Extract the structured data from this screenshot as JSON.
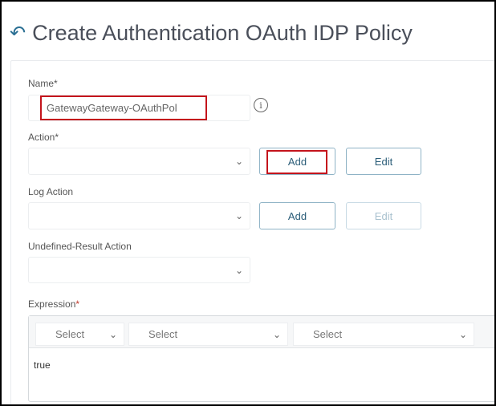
{
  "header": {
    "title": "Create Authentication OAuth IDP Policy",
    "back_icon": "back-arrow-icon"
  },
  "form": {
    "name": {
      "label": "Name",
      "required_mark": "*",
      "value": "GatewayGateway-OAuthPol"
    },
    "action": {
      "label": "Action",
      "required_mark": "*",
      "value": "",
      "add_label": "Add",
      "edit_label": "Edit"
    },
    "log_action": {
      "label": "Log Action",
      "value": "",
      "add_label": "Add",
      "edit_label": "Edit"
    },
    "undefined_result_action": {
      "label": "Undefined-Result Action",
      "value": ""
    },
    "expression": {
      "label": "Expression",
      "required_mark": "*",
      "selects": [
        "Select",
        "Select",
        "Select"
      ],
      "value": "true"
    }
  },
  "highlight_color": "#c4141c"
}
